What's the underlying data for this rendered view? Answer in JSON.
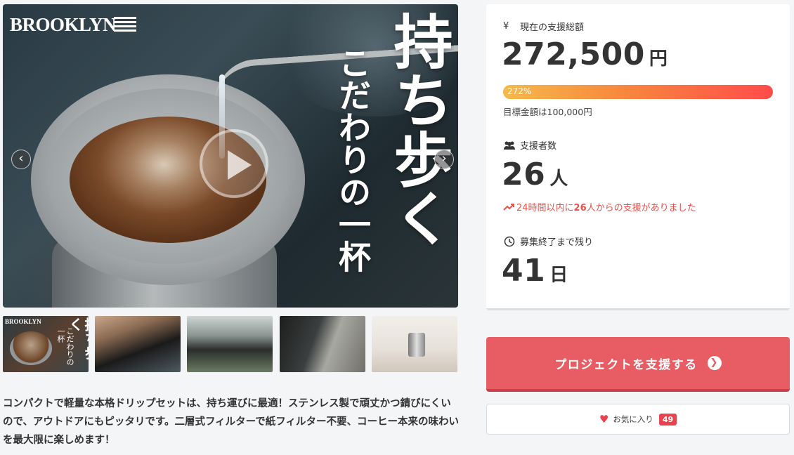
{
  "hero": {
    "logo_text": "BROOKLYN",
    "headline_large": "持ち歩く",
    "headline_sub": "こだわりの一杯",
    "prev_arrow": "‹",
    "next_arrow": "›"
  },
  "thumbnails": [
    {
      "logo": "BROOKLYN",
      "title": "持ち歩く",
      "sub": "こだわりの一杯"
    },
    {},
    {},
    {},
    {}
  ],
  "description": "コンパクトで軽量な本格ドリップセットは、持ち運びに最適！ステンレス製で頑丈かつ錆びにくいので、アウトドアにもピッタリです。二層式フィルターで紙フィルター不要、コーヒー本来の味わいを最大限に楽しめます！",
  "stats": {
    "total": {
      "icon": "yen-icon",
      "label": "現在の支援総額",
      "value": "272,500",
      "unit": "円",
      "progress_label": "272%",
      "progress_percent": 272,
      "goal_text": "目標金額は100,000円"
    },
    "backers": {
      "icon": "users-icon",
      "label": "支援者数",
      "value": "26",
      "unit": "人",
      "trend_prefix": "24時間以内に",
      "trend_count": "26",
      "trend_suffix": "人からの支援がありました"
    },
    "remaining": {
      "icon": "clock-icon",
      "label": "募集終了まで残り",
      "value": "41",
      "unit": "日"
    }
  },
  "support_button": {
    "label": "プロジェクトを支援する"
  },
  "favorite": {
    "label": "お気に入り",
    "count": "49"
  },
  "colors": {
    "accent": "#e85c63",
    "heart": "#e8424c",
    "trend": "#e8524a"
  }
}
